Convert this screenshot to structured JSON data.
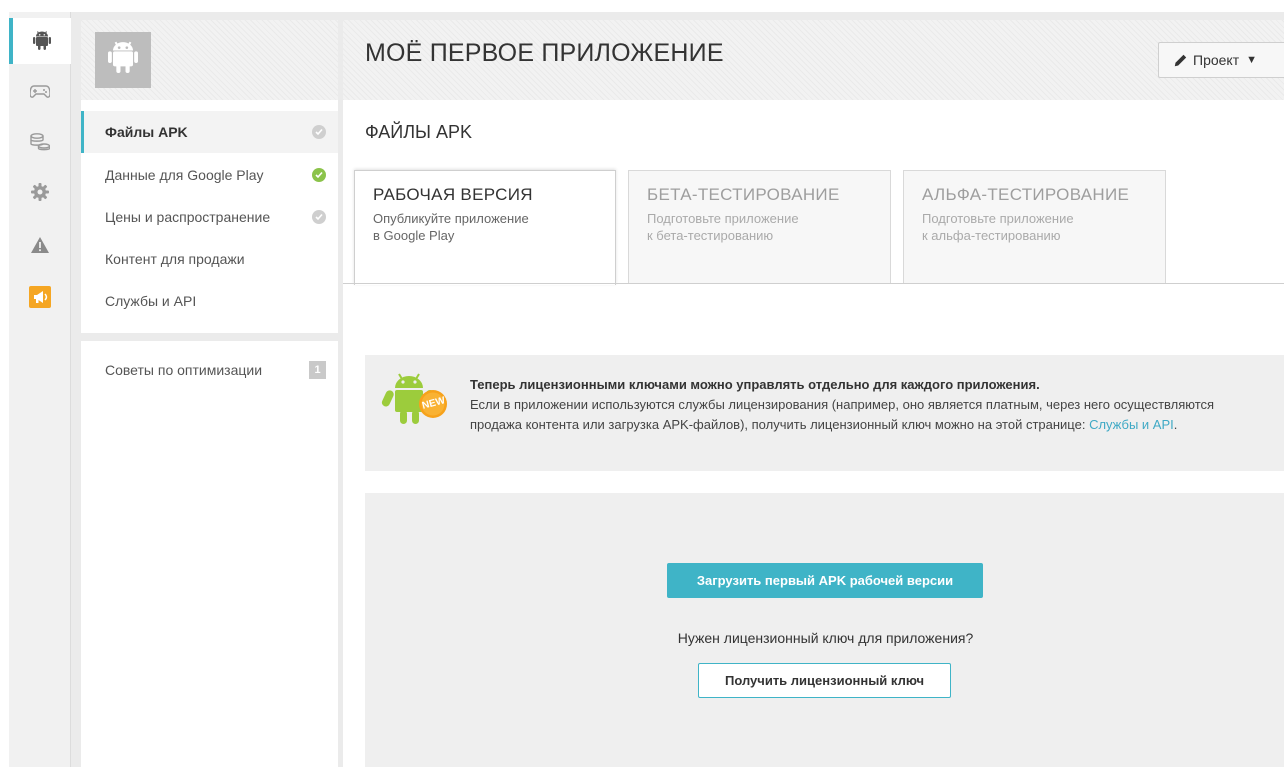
{
  "colors": {
    "accent": "#3fb4c7",
    "link": "#3fa9c5",
    "ok": "#8bc34a",
    "notification": "#f5a623",
    "inactive": "#cfcfcf"
  },
  "rail": {
    "items": [
      {
        "icon": "android-icon",
        "active": true
      },
      {
        "icon": "gamepad-icon",
        "active": false
      },
      {
        "icon": "coins-icon",
        "active": false
      },
      {
        "icon": "gear-icon",
        "active": false
      },
      {
        "icon": "warning-icon",
        "active": false
      },
      {
        "icon": "megaphone-icon",
        "active": false
      }
    ]
  },
  "header": {
    "title": "МОЁ ПЕРВОЕ ПРИЛОЖЕНИЕ",
    "project_button": {
      "label": "Проект",
      "icon": "pencil-icon"
    }
  },
  "sidebar": {
    "items": [
      {
        "label": "Файлы APK",
        "status": "inactive",
        "active": true
      },
      {
        "label": "Данные для Google Play",
        "status": "ok",
        "active": false
      },
      {
        "label": "Цены и распространение",
        "status": "inactive",
        "active": false
      },
      {
        "label": "Контент для продажи"
      },
      {
        "label": "Службы и API"
      }
    ],
    "optimization": {
      "label": "Советы по оптимизации",
      "badge": "1"
    }
  },
  "main": {
    "section_title": "ФАЙЛЫ APK",
    "tabs": [
      {
        "title": "РАБОЧАЯ ВЕРСИЯ",
        "description": "Опубликуйте приложение в Google Play",
        "active": true
      },
      {
        "title": "БЕТА-ТЕСТИРОВАНИЕ",
        "description": "Подготовьте приложение к бета-тестированию",
        "active": false
      },
      {
        "title": "АЛЬФА-ТЕСТИРОВАНИЕ",
        "description": "Подготовьте приложение к альфа-тестированию",
        "active": false
      }
    ],
    "notice": {
      "badge": "NEW",
      "headline": "Теперь лицензионными ключами можно управлять отдельно для каждого приложения.",
      "body": "Если в приложении используются службы лицензирования (например, оно является платным, через него осуществляются продажа контента или загрузка APK-файлов), получить лицензионный ключ можно на этой странице: ",
      "link_text": "Службы и API",
      "tail": "."
    },
    "upload": {
      "upload_button": "Загрузить первый APK рабочей версии",
      "license_question": "Нужен лицензионный ключ для приложения?",
      "license_button": "Получить лицензионный ключ"
    }
  }
}
